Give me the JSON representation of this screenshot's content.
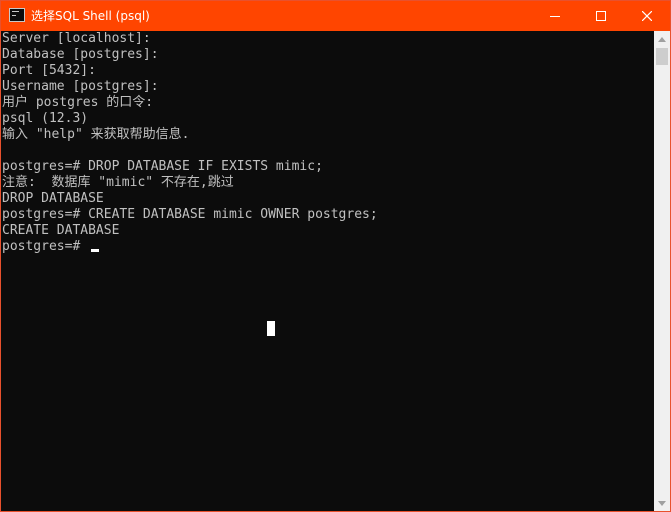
{
  "window": {
    "title": "选择SQL Shell (psql)",
    "accent_color": "#ff4500",
    "app_icon": "console-icon"
  },
  "titlebar_buttons": {
    "minimize_icon": "minimize-icon",
    "maximize_icon": "maximize-icon",
    "close_icon": "close-icon"
  },
  "console": {
    "lines": [
      "Server [localhost]:",
      "Database [postgres]:",
      "Port [5432]:",
      "Username [postgres]:",
      "用户 postgres 的口令:",
      "psql (12.3)",
      "输入 \"help\" 来获取帮助信息.",
      "",
      "postgres=# DROP DATABASE IF EXISTS mimic;",
      "注意:  数据库 \"mimic\" 不存在,跳过",
      "DROP DATABASE",
      "postgres=# CREATE DATABASE mimic OWNER postgres;",
      "CREATE DATABASE",
      "postgres=# "
    ],
    "text_color": "#c0c0c0",
    "background_color": "#0c0c0c"
  },
  "scrollbar": {
    "up_icon": "scroll-up-arrow-icon",
    "down_icon": "scroll-down-arrow-icon"
  }
}
